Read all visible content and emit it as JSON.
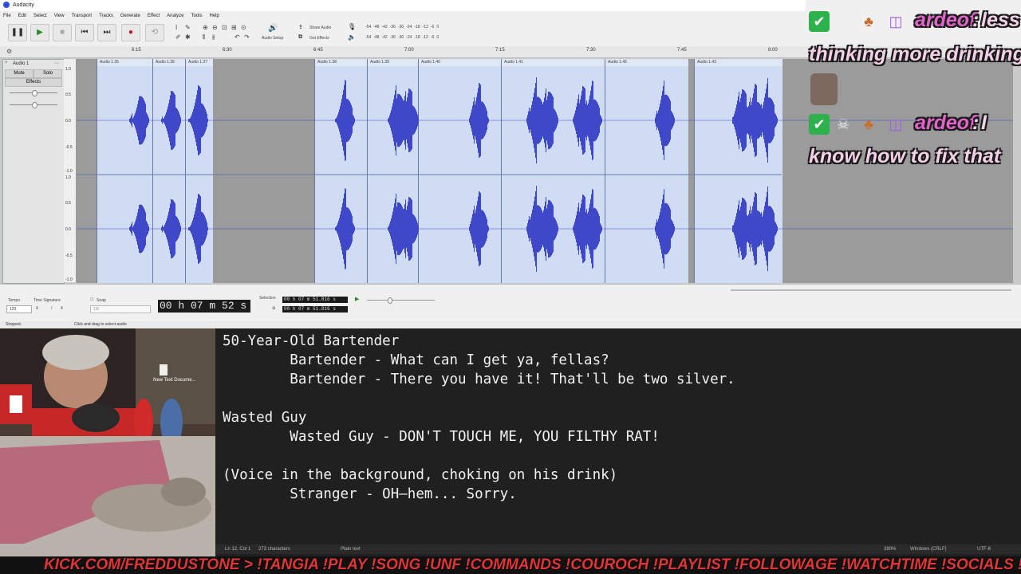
{
  "audacity": {
    "title": "Audacity",
    "menu": [
      "File",
      "Edit",
      "Select",
      "View",
      "Transport",
      "Tracks",
      "Generate",
      "Effect",
      "Analyze",
      "Tools",
      "Help"
    ],
    "toolbar": {
      "audio_setup": "Audio Setup",
      "share_audio": "Share Audio",
      "get_effects": "Get Effects",
      "meter_ticks": [
        "-54",
        "-48",
        "-42",
        "-36",
        "-30",
        "-24",
        "-18",
        "-12",
        "-6",
        "0"
      ]
    },
    "ruler_ticks": [
      "6:15",
      "6:30",
      "6:45",
      "7:00",
      "7:15",
      "7:30",
      "7:45",
      "8:00"
    ],
    "track": {
      "name": "Audio 1",
      "mute": "Mute",
      "solo": "Solo",
      "effects": "Effects",
      "scale": [
        "1.0",
        "0.5",
        "0.0",
        "-0.5",
        "-1.0",
        "1.0",
        "0.5",
        "0.0",
        "-0.5",
        "-1.0"
      ]
    },
    "clips": [
      "Audio 1.35",
      "Audio 1.36",
      "Audio 1.37",
      "Audio 1.38",
      "Audio 1.39",
      "Audio 1.40",
      "Audio 1.41",
      "Audio 1.42",
      "Audio 1.43"
    ],
    "bottom": {
      "tempo_label": "Tempo",
      "tempo_value": "120",
      "time_sig_label": "Time Signature",
      "time_sig_num": "4",
      "time_sig_den": "4",
      "snap_label": "Snap",
      "snap_value": "1/8",
      "time_display": "00 h 07 m 52 s",
      "selection_label": "Selection",
      "selection_start": "00 h 07 m 51.816 s",
      "selection_end": "00 h 07 m 51.816 s"
    },
    "status": {
      "state": "Stopped.",
      "hint": "Click and drag to select audio"
    }
  },
  "chat": {
    "messages": [
      {
        "user": "ardeof",
        "text_1": "less",
        "text_2": "thinking more drinking"
      },
      {
        "user": "ardeof",
        "text_1": "I",
        "text_2": "know how to fix that"
      }
    ]
  },
  "notepad": {
    "lines": [
      "50-Year-Old Bartender",
      "        Bartender - What can I get ya, fellas?",
      "        Bartender - There you have it! That'll be two silver.",
      "",
      "Wasted Guy",
      "        Wasted Guy - DON'T TOUCH ME, YOU FILTHY RAT!",
      "",
      "(Voice in the background, choking on his drink)",
      "        Stranger - OH—hem... Sorry."
    ],
    "status": {
      "position": "Ln 12, Col 1",
      "chars": "273 characters",
      "format": "Plain text",
      "zoom": "280%",
      "eol": "Windows (CRLF)",
      "encoding": "UTF-8"
    }
  },
  "desktop": {
    "icon_label": "New Text Docume..."
  },
  "ticker": {
    "text": "KICK.COM/FREDDUSTONE > !TANGIA !PLAY !SONG !UNF !COMMANDS !COUROCH !PLAYLIST !FOLLOWAGE !WATCHTIME !SOCIALS !SOU"
  },
  "colors": {
    "clip_bg": "#cfdcf3",
    "waveform": "#3e48c8",
    "chat_user": "#e064c9",
    "chat_text": "#f4d0e6",
    "ticker": "#e23535",
    "notepad_bg": "#202020"
  }
}
